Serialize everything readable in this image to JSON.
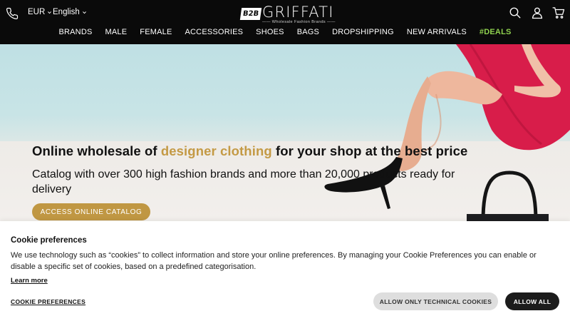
{
  "header": {
    "currency": "EUR",
    "language": "English",
    "logo": {
      "badge": "B2B",
      "word": "GRIFFATI",
      "tagline": "Wholesale Fashion Brands"
    },
    "nav": [
      "BRANDS",
      "MALE",
      "FEMALE",
      "ACCESSORIES",
      "SHOES",
      "BAGS",
      "DROPSHIPPING",
      "NEW ARRIVALS",
      "#DEALS"
    ],
    "icons": [
      "phone-icon",
      "search-icon",
      "user-icon",
      "cart-icon"
    ]
  },
  "hero": {
    "title_pre": "Online wholesale of ",
    "title_highlight": "designer clothing",
    "title_post": " for your shop at the best price",
    "subtitle": "Catalog with over 300 high fashion brands and more than 20,000 products ready for delivery",
    "cta": "ACCESS ONLINE CATALOG"
  },
  "cookie": {
    "title": "Cookie preferences",
    "text": "We use technology such as “cookies” to collect information and store your online preferences. By managing your Cookie Preferences you can enable or disable a specific set of cookies, based on a predefined categorisation.",
    "learn_more": "Learn more",
    "preferences": "COOKIE PREFERENCES",
    "allow_technical": "ALLOW ONLY TECHNICAL COOKIES",
    "allow_all": "ALLOW ALL"
  },
  "colors": {
    "header_bg": "#0a0a0a",
    "accent_gold": "#c09743",
    "deals_green": "#8fd14f",
    "dress_red": "#d81d4a"
  }
}
